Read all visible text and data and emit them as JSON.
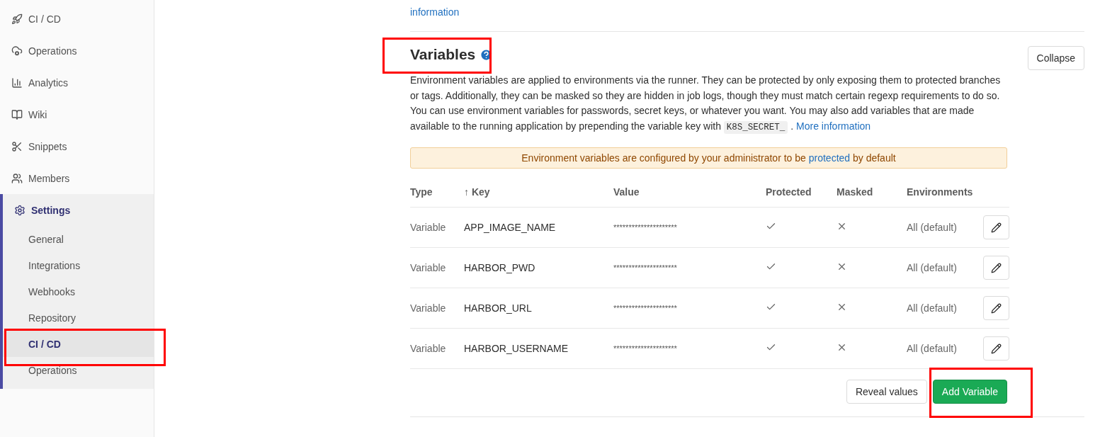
{
  "sidebar": {
    "items": [
      {
        "label": "CI / CD",
        "selected": false
      },
      {
        "label": "Operations",
        "selected": false
      },
      {
        "label": "Analytics",
        "selected": false
      },
      {
        "label": "Wiki",
        "selected": false
      },
      {
        "label": "Snippets",
        "selected": false
      },
      {
        "label": "Members",
        "selected": false
      },
      {
        "label": "Settings",
        "selected": true,
        "expanded": true,
        "children": [
          {
            "label": "General",
            "selected": false
          },
          {
            "label": "Integrations",
            "selected": false
          },
          {
            "label": "Webhooks",
            "selected": false
          },
          {
            "label": "Repository",
            "selected": false
          },
          {
            "label": "CI / CD",
            "selected": true,
            "highlighted": true
          },
          {
            "label": "Operations",
            "selected": false
          }
        ]
      }
    ]
  },
  "previous_section": {
    "link": "information"
  },
  "variables": {
    "title": "Variables",
    "title_highlighted": true,
    "collapse_button": "Collapse",
    "description": "Environment variables are applied to environments via the runner. They can be protected by only exposing them to protected branches or tags. Additionally, they can be masked so they are hidden in job logs, though they must match certain regexp requirements to do so. You can use environment variables for passwords, secret keys, or whatever you want. You may also add variables that are made available to the running application by prepending the variable key with",
    "code": "K8S_SECRET_",
    "after_code": ".",
    "more_link": "More information",
    "notice": {
      "before": "Environment variables are configured by your administrator to be",
      "link": "protected",
      "after": "by default"
    },
    "table": {
      "columns": [
        "Type",
        "Key",
        "Value",
        "Protected",
        "Masked",
        "Environments"
      ],
      "sort_arrow": "↑",
      "rows": [
        {
          "type": "Variable",
          "key": "APP_IMAGE_NAME",
          "value": "*********************",
          "protected": true,
          "masked": false,
          "environments": "All (default)"
        },
        {
          "type": "Variable",
          "key": "HARBOR_PWD",
          "value": "*********************",
          "protected": true,
          "masked": false,
          "environments": "All (default)"
        },
        {
          "type": "Variable",
          "key": "HARBOR_URL",
          "value": "*********************",
          "protected": true,
          "masked": false,
          "environments": "All (default)"
        },
        {
          "type": "Variable",
          "key": "HARBOR_USERNAME",
          "value": "*********************",
          "protected": true,
          "masked": false,
          "environments": "All (default)"
        }
      ]
    },
    "reveal_button": "Reveal values",
    "add_button": "Add Variable",
    "add_highlighted": true
  }
}
